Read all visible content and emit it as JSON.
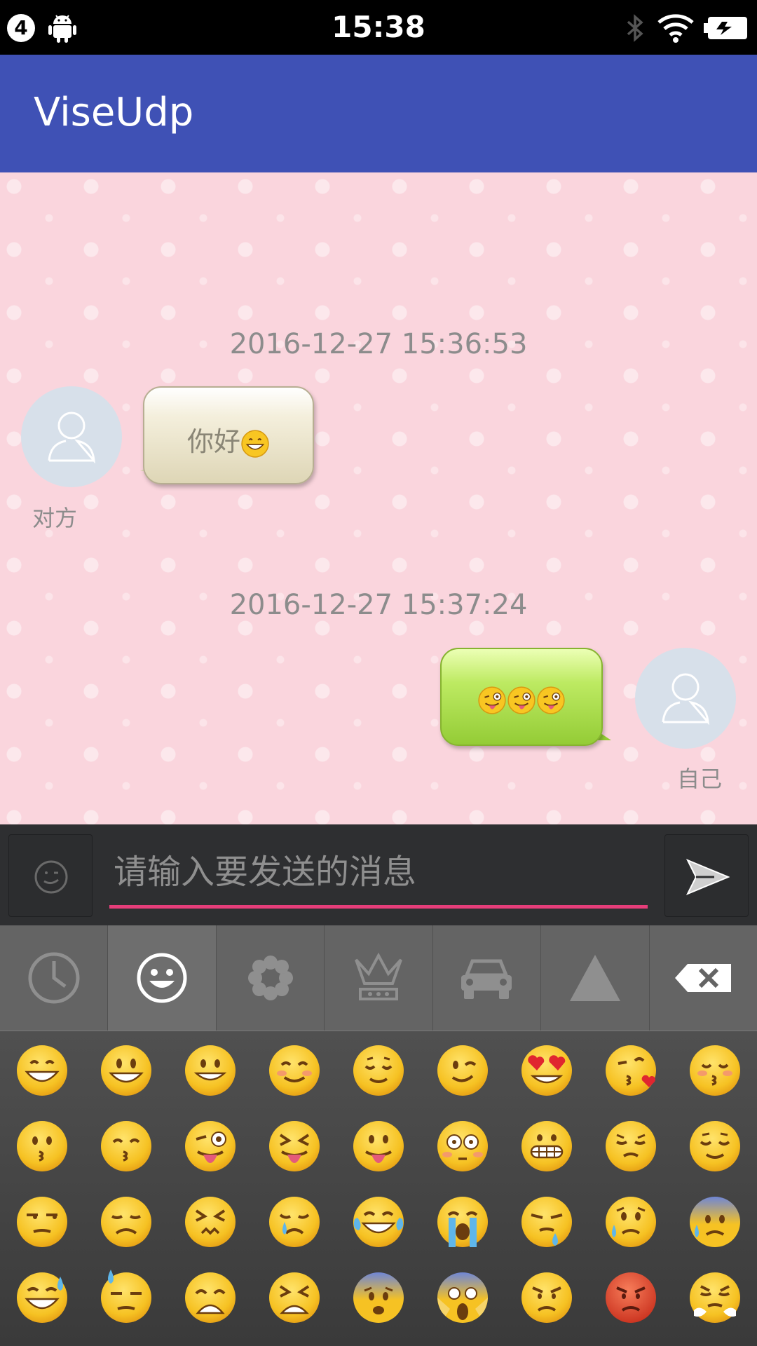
{
  "status_bar": {
    "badge": "4",
    "time": "15:38",
    "icons": [
      "android-icon",
      "bluetooth-icon",
      "wifi-icon",
      "battery-icon"
    ]
  },
  "app_bar": {
    "title": "ViseUdp",
    "color": "#3f51b5"
  },
  "chat": {
    "messages": [
      {
        "timestamp": "2016-12-27 15:36:53",
        "sender_label": "对方",
        "side": "left",
        "text": "你好",
        "emojis": [
          "grin-icon"
        ]
      },
      {
        "timestamp": "2016-12-27 15:37:24",
        "sender_label": "自己",
        "side": "right",
        "text": "",
        "emojis": [
          "wink-tongue-icon",
          "wink-tongue-icon",
          "wink-tongue-icon"
        ]
      }
    ]
  },
  "input_bar": {
    "placeholder": "请输入要发送的消息",
    "value": "",
    "accent": "#e63e7a"
  },
  "emoji_tabs": [
    {
      "icon": "recent-clock-icon",
      "active": false
    },
    {
      "icon": "smiley-icon",
      "active": true
    },
    {
      "icon": "flower-icon",
      "active": false
    },
    {
      "icon": "crown-icon",
      "active": false
    },
    {
      "icon": "car-icon",
      "active": false
    },
    {
      "icon": "triangle-symbol-icon",
      "active": false
    },
    {
      "icon": "backspace-icon",
      "active": false
    }
  ],
  "emoji_grid": [
    [
      "grin",
      "smiley",
      "grinning",
      "blush",
      "relaxed",
      "wink",
      "heart-eyes",
      "kiss-heart",
      "kissing-closed"
    ],
    [
      "kissing",
      "kissing-smile",
      "tongue-wink",
      "tongue-squint",
      "tongue",
      "flushed",
      "grimace",
      "pensive",
      "relieved"
    ],
    [
      "unamused",
      "disappointed",
      "persevere",
      "cry",
      "joy",
      "sob",
      "sleepy",
      "sad-sweat",
      "cold-sweat"
    ],
    [
      "sweat-smile",
      "sweat",
      "weary",
      "tired",
      "fearful",
      "scream",
      "angry",
      "rage",
      "triumph"
    ]
  ]
}
